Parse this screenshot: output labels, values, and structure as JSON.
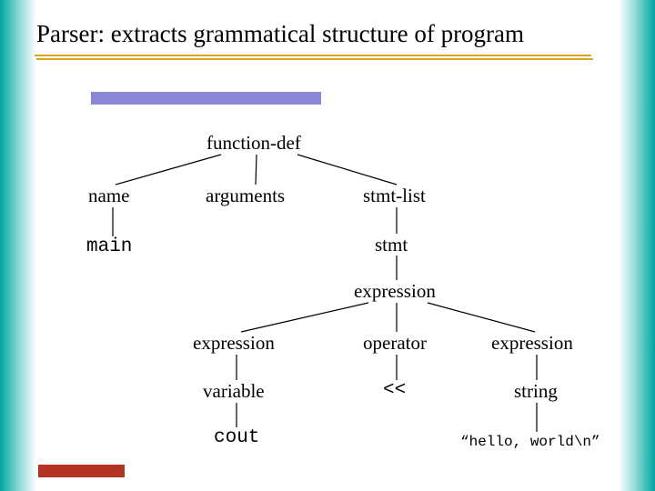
{
  "title": "Parser: extracts grammatical structure of program",
  "tree": {
    "function_def": "function-def",
    "name": "name",
    "arguments": "arguments",
    "stmt_list": "stmt-list",
    "main": "main",
    "stmt": "stmt",
    "expression_top": "expression",
    "expression_left": "expression",
    "operator": "operator",
    "expression_right": "expression",
    "variable": "variable",
    "op_value": "<<",
    "string_label": "string",
    "cout": "cout",
    "string_literal": "“hello, world\\n”"
  },
  "colors": {
    "teal": "#00a5a0",
    "gold_underline": "#daa520",
    "purple_bar": "#8b87d6",
    "footer_red": "#b23223"
  }
}
